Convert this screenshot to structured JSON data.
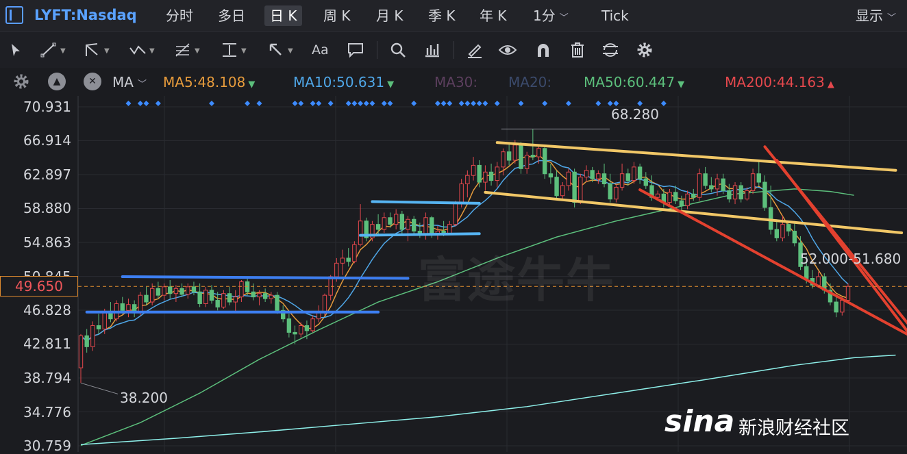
{
  "ticker": "LYFT:Nasdaq",
  "periods": [
    "分时",
    "多日",
    "日 K",
    "周 K",
    "月 K",
    "季 K",
    "年 K",
    "1分",
    "Tick"
  ],
  "active_period": "日 K",
  "display_label": "显示",
  "ma_bar": {
    "ma_label": "MA",
    "items": [
      {
        "text": "MA5:48.108",
        "color": "#e69b3c",
        "arrow": "down"
      },
      {
        "text": "MA10:50.631",
        "color": "#4fa7e8",
        "arrow": "down"
      },
      {
        "text": "MA30:",
        "color": "#5c3f5e",
        "arrow": ""
      },
      {
        "text": "MA20:",
        "color": "#3b4a6b",
        "arrow": ""
      },
      {
        "text": "MA50:60.447",
        "color": "#5cbf7c",
        "arrow": "down"
      },
      {
        "text": "MA200:44.163",
        "color": "#e5484d",
        "arrow": "up"
      }
    ]
  },
  "toolbar_icons": [
    "cursor-icon",
    "line-tool-icon",
    "channel-tool-icon",
    "wave-tool-icon",
    "fib-tool-icon",
    "horizontal-line-icon",
    "arrow-tool-icon",
    "text-tool-icon",
    "comment-icon",
    "zoom-icon",
    "indicator-icon",
    "pen-icon",
    "eye-icon",
    "magnet-icon",
    "trash-icon",
    "sync-icon",
    "settings-icon"
  ],
  "annotations": {
    "high_label": "68.280",
    "low_label": "38.200",
    "range_label": "52.000-51.680"
  },
  "current_price": "49.650",
  "watermark": "富途牛牛",
  "sina": {
    "logo": "sina",
    "text": "新浪财经社区"
  },
  "chart_data": {
    "type": "candlestick",
    "title": "",
    "y_ticks": [
      "70.931",
      "66.914",
      "62.897",
      "58.880",
      "54.863",
      "50.845",
      "46.828",
      "42.811",
      "38.794",
      "34.776",
      "30.759"
    ],
    "ylim": [
      30.759,
      70.931
    ],
    "grid": true,
    "up_color": "#e5484d",
    "down_color": "#5cbf7c",
    "candles": [
      {
        "o": 40.0,
        "h": 44.0,
        "l": 38.2,
        "c": 43.8
      },
      {
        "o": 43.8,
        "h": 44.6,
        "l": 41.8,
        "c": 42.5
      },
      {
        "o": 42.5,
        "h": 45.5,
        "l": 42.0,
        "c": 45.0
      },
      {
        "o": 45.0,
        "h": 46.4,
        "l": 44.0,
        "c": 44.6
      },
      {
        "o": 44.6,
        "h": 47.0,
        "l": 44.0,
        "c": 46.5
      },
      {
        "o": 46.5,
        "h": 47.8,
        "l": 45.4,
        "c": 45.8
      },
      {
        "o": 45.8,
        "h": 48.0,
        "l": 45.5,
        "c": 47.6
      },
      {
        "o": 47.6,
        "h": 48.4,
        "l": 46.4,
        "c": 46.8
      },
      {
        "o": 46.8,
        "h": 48.2,
        "l": 46.0,
        "c": 47.5
      },
      {
        "o": 47.5,
        "h": 48.0,
        "l": 46.0,
        "c": 46.5
      },
      {
        "o": 46.5,
        "h": 49.0,
        "l": 46.2,
        "c": 48.6
      },
      {
        "o": 48.6,
        "h": 49.6,
        "l": 47.4,
        "c": 47.8
      },
      {
        "o": 47.8,
        "h": 50.0,
        "l": 47.4,
        "c": 49.4
      },
      {
        "o": 49.4,
        "h": 50.2,
        "l": 48.2,
        "c": 48.6
      },
      {
        "o": 48.6,
        "h": 50.0,
        "l": 48.0,
        "c": 49.6
      },
      {
        "o": 49.6,
        "h": 50.4,
        "l": 48.2,
        "c": 48.8
      },
      {
        "o": 48.8,
        "h": 49.8,
        "l": 47.8,
        "c": 49.4
      },
      {
        "o": 49.4,
        "h": 50.0,
        "l": 48.4,
        "c": 48.7
      },
      {
        "o": 48.7,
        "h": 50.0,
        "l": 48.2,
        "c": 49.6
      },
      {
        "o": 49.6,
        "h": 50.2,
        "l": 48.6,
        "c": 49.0
      },
      {
        "o": 49.0,
        "h": 50.0,
        "l": 47.2,
        "c": 47.6
      },
      {
        "o": 47.6,
        "h": 49.6,
        "l": 47.2,
        "c": 49.2
      },
      {
        "o": 49.2,
        "h": 49.8,
        "l": 47.6,
        "c": 48.0
      },
      {
        "o": 48.0,
        "h": 49.0,
        "l": 46.8,
        "c": 47.2
      },
      {
        "o": 47.2,
        "h": 49.2,
        "l": 47.0,
        "c": 48.8
      },
      {
        "o": 48.8,
        "h": 49.6,
        "l": 47.4,
        "c": 47.8
      },
      {
        "o": 47.8,
        "h": 49.2,
        "l": 46.6,
        "c": 48.4
      },
      {
        "o": 48.4,
        "h": 50.4,
        "l": 47.8,
        "c": 50.2
      },
      {
        "o": 50.2,
        "h": 50.6,
        "l": 48.6,
        "c": 49.0
      },
      {
        "o": 49.0,
        "h": 50.0,
        "l": 48.0,
        "c": 48.4
      },
      {
        "o": 48.4,
        "h": 49.2,
        "l": 47.4,
        "c": 48.8
      },
      {
        "o": 48.8,
        "h": 49.4,
        "l": 47.8,
        "c": 48.2
      },
      {
        "o": 48.2,
        "h": 49.0,
        "l": 47.6,
        "c": 48.6
      },
      {
        "o": 48.6,
        "h": 49.0,
        "l": 46.4,
        "c": 46.8
      },
      {
        "o": 46.8,
        "h": 47.4,
        "l": 45.4,
        "c": 45.8
      },
      {
        "o": 45.8,
        "h": 46.4,
        "l": 43.6,
        "c": 44.2
      },
      {
        "o": 44.2,
        "h": 45.0,
        "l": 42.8,
        "c": 44.0
      },
      {
        "o": 44.0,
        "h": 45.4,
        "l": 43.6,
        "c": 45.0
      },
      {
        "o": 45.0,
        "h": 45.6,
        "l": 43.4,
        "c": 44.4
      },
      {
        "o": 44.4,
        "h": 46.2,
        "l": 44.2,
        "c": 45.8
      },
      {
        "o": 45.8,
        "h": 47.4,
        "l": 45.4,
        "c": 46.6
      },
      {
        "o": 46.6,
        "h": 48.8,
        "l": 46.2,
        "c": 48.6
      },
      {
        "o": 48.6,
        "h": 51.0,
        "l": 48.0,
        "c": 50.8
      },
      {
        "o": 50.8,
        "h": 53.0,
        "l": 50.2,
        "c": 52.4
      },
      {
        "o": 52.4,
        "h": 54.0,
        "l": 51.0,
        "c": 53.0
      },
      {
        "o": 53.0,
        "h": 54.2,
        "l": 52.0,
        "c": 52.6
      },
      {
        "o": 52.6,
        "h": 55.0,
        "l": 52.4,
        "c": 54.6
      },
      {
        "o": 54.6,
        "h": 59.4,
        "l": 54.4,
        "c": 57.4
      },
      {
        "o": 57.4,
        "h": 57.8,
        "l": 55.0,
        "c": 55.4
      },
      {
        "o": 55.4,
        "h": 57.4,
        "l": 55.0,
        "c": 57.0
      },
      {
        "o": 57.0,
        "h": 58.2,
        "l": 55.8,
        "c": 56.4
      },
      {
        "o": 56.4,
        "h": 58.4,
        "l": 56.0,
        "c": 57.8
      },
      {
        "o": 57.8,
        "h": 58.4,
        "l": 56.6,
        "c": 57.0
      },
      {
        "o": 57.0,
        "h": 58.8,
        "l": 56.4,
        "c": 58.2
      },
      {
        "o": 58.2,
        "h": 58.6,
        "l": 55.8,
        "c": 56.4
      },
      {
        "o": 56.4,
        "h": 58.0,
        "l": 55.0,
        "c": 57.6
      },
      {
        "o": 57.6,
        "h": 58.0,
        "l": 55.8,
        "c": 56.2
      },
      {
        "o": 56.2,
        "h": 57.2,
        "l": 55.4,
        "c": 55.8
      },
      {
        "o": 55.8,
        "h": 58.4,
        "l": 55.2,
        "c": 57.8
      },
      {
        "o": 57.8,
        "h": 58.0,
        "l": 55.4,
        "c": 55.8
      },
      {
        "o": 55.8,
        "h": 56.8,
        "l": 55.2,
        "c": 56.2
      },
      {
        "o": 56.2,
        "h": 57.4,
        "l": 55.6,
        "c": 55.9
      },
      {
        "o": 55.9,
        "h": 57.4,
        "l": 55.8,
        "c": 57.0
      },
      {
        "o": 57.0,
        "h": 59.8,
        "l": 56.8,
        "c": 59.6
      },
      {
        "o": 59.6,
        "h": 62.4,
        "l": 59.0,
        "c": 61.8
      },
      {
        "o": 61.8,
        "h": 63.4,
        "l": 60.2,
        "c": 62.8
      },
      {
        "o": 62.8,
        "h": 65.0,
        "l": 62.2,
        "c": 64.0
      },
      {
        "o": 64.0,
        "h": 64.6,
        "l": 61.4,
        "c": 62.0
      },
      {
        "o": 62.0,
        "h": 64.0,
        "l": 61.0,
        "c": 63.2
      },
      {
        "o": 63.2,
        "h": 64.2,
        "l": 61.6,
        "c": 62.2
      },
      {
        "o": 62.2,
        "h": 64.4,
        "l": 61.4,
        "c": 63.8
      },
      {
        "o": 63.8,
        "h": 66.0,
        "l": 62.8,
        "c": 65.6
      },
      {
        "o": 65.6,
        "h": 66.6,
        "l": 64.0,
        "c": 64.6
      },
      {
        "o": 64.6,
        "h": 67.0,
        "l": 64.2,
        "c": 66.4
      },
      {
        "o": 66.4,
        "h": 66.8,
        "l": 63.0,
        "c": 63.6
      },
      {
        "o": 63.6,
        "h": 65.6,
        "l": 63.0,
        "c": 65.2
      },
      {
        "o": 65.2,
        "h": 68.28,
        "l": 64.6,
        "c": 65.0
      },
      {
        "o": 65.0,
        "h": 66.4,
        "l": 64.2,
        "c": 66.0
      },
      {
        "o": 66.0,
        "h": 66.4,
        "l": 62.4,
        "c": 63.0
      },
      {
        "o": 63.0,
        "h": 64.2,
        "l": 61.8,
        "c": 62.6
      },
      {
        "o": 62.6,
        "h": 63.4,
        "l": 60.0,
        "c": 60.4
      },
      {
        "o": 60.4,
        "h": 62.0,
        "l": 60.0,
        "c": 61.6
      },
      {
        "o": 61.6,
        "h": 63.6,
        "l": 61.0,
        "c": 63.2
      },
      {
        "o": 63.2,
        "h": 63.6,
        "l": 59.0,
        "c": 59.6
      },
      {
        "o": 59.6,
        "h": 63.0,
        "l": 59.4,
        "c": 62.6
      },
      {
        "o": 62.6,
        "h": 64.0,
        "l": 62.0,
        "c": 63.4
      },
      {
        "o": 63.4,
        "h": 63.8,
        "l": 62.0,
        "c": 62.4
      },
      {
        "o": 62.4,
        "h": 63.4,
        "l": 61.8,
        "c": 63.0
      },
      {
        "o": 63.0,
        "h": 64.2,
        "l": 61.4,
        "c": 61.8
      },
      {
        "o": 61.8,
        "h": 63.0,
        "l": 59.6,
        "c": 60.0
      },
      {
        "o": 60.0,
        "h": 61.8,
        "l": 59.6,
        "c": 61.4
      },
      {
        "o": 61.4,
        "h": 64.2,
        "l": 61.0,
        "c": 63.0
      },
      {
        "o": 63.0,
        "h": 63.6,
        "l": 61.6,
        "c": 62.2
      },
      {
        "o": 62.2,
        "h": 64.4,
        "l": 61.8,
        "c": 63.8
      },
      {
        "o": 63.8,
        "h": 64.2,
        "l": 61.8,
        "c": 62.4
      },
      {
        "o": 62.4,
        "h": 63.2,
        "l": 61.2,
        "c": 61.6
      },
      {
        "o": 61.6,
        "h": 62.8,
        "l": 59.8,
        "c": 60.2
      },
      {
        "o": 60.2,
        "h": 61.0,
        "l": 59.8,
        "c": 60.6
      },
      {
        "o": 60.6,
        "h": 61.2,
        "l": 59.0,
        "c": 59.6
      },
      {
        "o": 59.6,
        "h": 61.2,
        "l": 59.2,
        "c": 60.8
      },
      {
        "o": 60.8,
        "h": 61.6,
        "l": 59.4,
        "c": 59.8
      },
      {
        "o": 59.8,
        "h": 60.4,
        "l": 58.6,
        "c": 59.2
      },
      {
        "o": 59.2,
        "h": 61.0,
        "l": 58.8,
        "c": 60.6
      },
      {
        "o": 60.6,
        "h": 61.2,
        "l": 59.8,
        "c": 60.2
      },
      {
        "o": 60.2,
        "h": 63.6,
        "l": 59.8,
        "c": 63.0
      },
      {
        "o": 63.0,
        "h": 63.8,
        "l": 61.2,
        "c": 61.6
      },
      {
        "o": 61.6,
        "h": 62.6,
        "l": 60.8,
        "c": 61.2
      },
      {
        "o": 61.2,
        "h": 63.0,
        "l": 60.4,
        "c": 62.4
      },
      {
        "o": 62.4,
        "h": 63.0,
        "l": 60.6,
        "c": 61.0
      },
      {
        "o": 61.0,
        "h": 61.8,
        "l": 59.6,
        "c": 60.0
      },
      {
        "o": 60.0,
        "h": 62.0,
        "l": 59.4,
        "c": 61.6
      },
      {
        "o": 61.6,
        "h": 62.0,
        "l": 59.6,
        "c": 60.0
      },
      {
        "o": 60.0,
        "h": 61.4,
        "l": 59.8,
        "c": 61.0
      },
      {
        "o": 61.0,
        "h": 63.6,
        "l": 60.6,
        "c": 63.0
      },
      {
        "o": 63.0,
        "h": 64.6,
        "l": 61.6,
        "c": 62.0
      },
      {
        "o": 62.0,
        "h": 62.8,
        "l": 58.6,
        "c": 59.0
      },
      {
        "o": 59.0,
        "h": 61.6,
        "l": 55.8,
        "c": 56.4
      },
      {
        "o": 56.4,
        "h": 57.6,
        "l": 55.0,
        "c": 55.4
      },
      {
        "o": 55.4,
        "h": 58.0,
        "l": 55.0,
        "c": 57.0
      },
      {
        "o": 57.0,
        "h": 57.4,
        "l": 55.6,
        "c": 56.2
      },
      {
        "o": 56.2,
        "h": 57.4,
        "l": 54.4,
        "c": 54.8
      },
      {
        "o": 54.8,
        "h": 55.6,
        "l": 51.6,
        "c": 52.0
      },
      {
        "o": 52.0,
        "h": 53.2,
        "l": 50.0,
        "c": 50.6
      },
      {
        "o": 50.6,
        "h": 51.6,
        "l": 49.4,
        "c": 49.8
      },
      {
        "o": 49.8,
        "h": 51.4,
        "l": 49.6,
        "c": 50.8
      },
      {
        "o": 50.8,
        "h": 51.2,
        "l": 48.8,
        "c": 49.2
      },
      {
        "o": 49.2,
        "h": 50.0,
        "l": 47.4,
        "c": 47.8
      },
      {
        "o": 47.8,
        "h": 48.6,
        "l": 46.0,
        "c": 46.6
      },
      {
        "o": 46.6,
        "h": 48.4,
        "l": 46.2,
        "c": 48.0
      },
      {
        "o": 48.0,
        "h": 50.0,
        "l": 47.6,
        "c": 49.65
      }
    ],
    "ma_lines": [
      {
        "name": "MA5",
        "color": "#e69b3c",
        "period": 5
      },
      {
        "name": "MA10",
        "color": "#4fa7e8",
        "period": 10
      },
      {
        "name": "MA50",
        "color": "#5cbf7c",
        "points": [
          [
            0,
            30.8
          ],
          [
            10,
            33.5
          ],
          [
            20,
            37.0
          ],
          [
            30,
            41.0
          ],
          [
            40,
            44.5
          ],
          [
            50,
            47.8
          ],
          [
            60,
            50.2
          ],
          [
            70,
            53.0
          ],
          [
            80,
            55.5
          ],
          [
            90,
            57.4
          ],
          [
            100,
            59.0
          ],
          [
            110,
            60.6
          ],
          [
            120,
            61.2
          ],
          [
            126,
            60.9
          ],
          [
            130,
            60.447
          ]
        ]
      },
      {
        "name": "MA200",
        "color": "#8ef0ea",
        "points": [
          [
            0,
            30.9
          ],
          [
            15,
            31.6
          ],
          [
            30,
            32.4
          ],
          [
            45,
            33.3
          ],
          [
            60,
            34.2
          ],
          [
            75,
            35.4
          ],
          [
            90,
            37.0
          ],
          [
            105,
            38.6
          ],
          [
            120,
            40.3
          ],
          [
            130,
            41.2
          ],
          [
            137,
            41.5
          ]
        ]
      }
    ],
    "events_row": [
      8,
      10,
      11,
      13,
      22,
      28,
      30,
      36,
      37,
      39,
      40,
      42,
      45,
      46,
      47,
      48,
      49,
      51,
      52,
      56,
      60,
      61,
      62,
      64,
      65,
      66,
      67,
      68,
      70,
      74,
      78,
      82,
      87,
      89,
      90,
      94,
      98
    ]
  }
}
